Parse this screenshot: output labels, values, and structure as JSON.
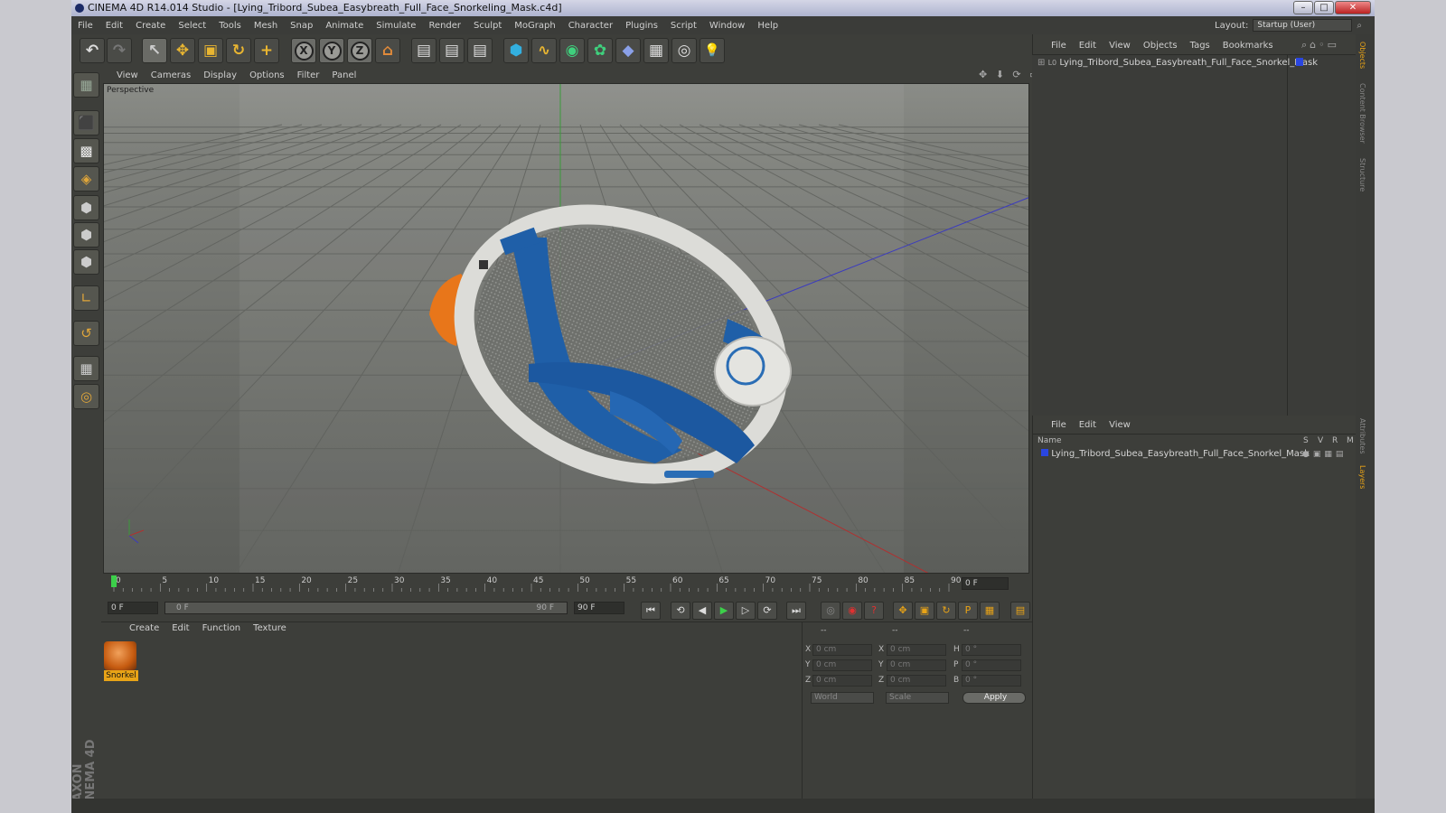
{
  "window": {
    "title": "CINEMA 4D R14.014 Studio - [Lying_Tribord_Subea_Easybreath_Full_Face_Snorkeling_Mask.c4d]",
    "minimize": "–",
    "maximize": "□",
    "close": "✕"
  },
  "menubar": [
    "File",
    "Edit",
    "Create",
    "Select",
    "Tools",
    "Mesh",
    "Snap",
    "Animate",
    "Simulate",
    "Render",
    "Sculpt",
    "MoGraph",
    "Character",
    "Plugins",
    "Script",
    "Window",
    "Help"
  ],
  "layout": {
    "label": "Layout:",
    "value": "Startup (User)"
  },
  "toolbar": {
    "undo": "↶",
    "redo": "↷",
    "select": "↖",
    "move": "✥",
    "scale": "▣",
    "rotate": "↻",
    "live": "+",
    "x_axis": "X",
    "y_axis": "Y",
    "z_axis": "Z",
    "coord": "⌂",
    "render_view": "▤",
    "render_pic": "▤",
    "render_settings": "▤",
    "cube": "⬢",
    "spline": "∿",
    "nurbs": "◉",
    "array": "✿",
    "deformer": "◆",
    "scene": "▦",
    "camera": "◎",
    "light": "💡"
  },
  "viewport": {
    "menus": [
      "View",
      "Cameras",
      "Display",
      "Options",
      "Filter",
      "Panel"
    ],
    "label": "Perspective",
    "icons": "✥ ⬇ ⟳ ▭",
    "colors": {
      "background": "#878984",
      "grid": "#737570",
      "mask_blue": "#1f5fa8",
      "mask_orange": "#e8761a",
      "mask_white": "#e8e8e6"
    }
  },
  "timeline": {
    "ticks": [
      "0",
      "5",
      "10",
      "15",
      "20",
      "25",
      "30",
      "35",
      "40",
      "45",
      "50",
      "55",
      "60",
      "65",
      "70",
      "75",
      "80",
      "85",
      "90"
    ],
    "current_frame": "0 F",
    "start_field": "0 F",
    "range_start": "0 F",
    "range_end": "90 F",
    "end_field": "90 F"
  },
  "playback": [
    "⏮",
    "⟲",
    "◀",
    "▶",
    "▷",
    "⟳",
    "⏭"
  ],
  "material_panel": {
    "menus": [
      "Create",
      "Edit",
      "Function",
      "Texture"
    ],
    "material": {
      "name": "Snorkel"
    }
  },
  "attributes": {
    "header": [
      "--",
      "--",
      "--"
    ],
    "pos_labels": [
      "X",
      "Y",
      "Z"
    ],
    "pos_values": [
      "0 cm",
      "0 cm",
      "0 cm"
    ],
    "size_labels": [
      "X",
      "Y",
      "Z"
    ],
    "size_values": [
      "0 cm",
      "0 cm",
      "0 cm"
    ],
    "rot_labels": [
      "H",
      "P",
      "B"
    ],
    "rot_values": [
      "0 °",
      "0 °",
      "0 °"
    ],
    "coord_select": "World",
    "mode_select": "Scale",
    "apply": "Apply"
  },
  "object_manager": {
    "menus": [
      "File",
      "Edit",
      "View",
      "Objects",
      "Tags",
      "Bookmarks"
    ],
    "object": "Lying_Tribord_Subea_Easybreath_Full_Face_Snorkel_Mask",
    "lo": "L0"
  },
  "layer_manager": {
    "menus": [
      "File",
      "Edit",
      "View"
    ],
    "columns": {
      "name": "Name",
      "s": "S",
      "v": "V",
      "r": "R",
      "m": "M"
    },
    "object": "Lying_Tribord_Subea_Easybreath_Full_Face_Snorkel_Mask"
  },
  "side_tabs": [
    "Objects",
    "Content Browser",
    "Structure",
    "Attributes",
    "Layers"
  ],
  "branding": "MAXON CINEMA 4D"
}
